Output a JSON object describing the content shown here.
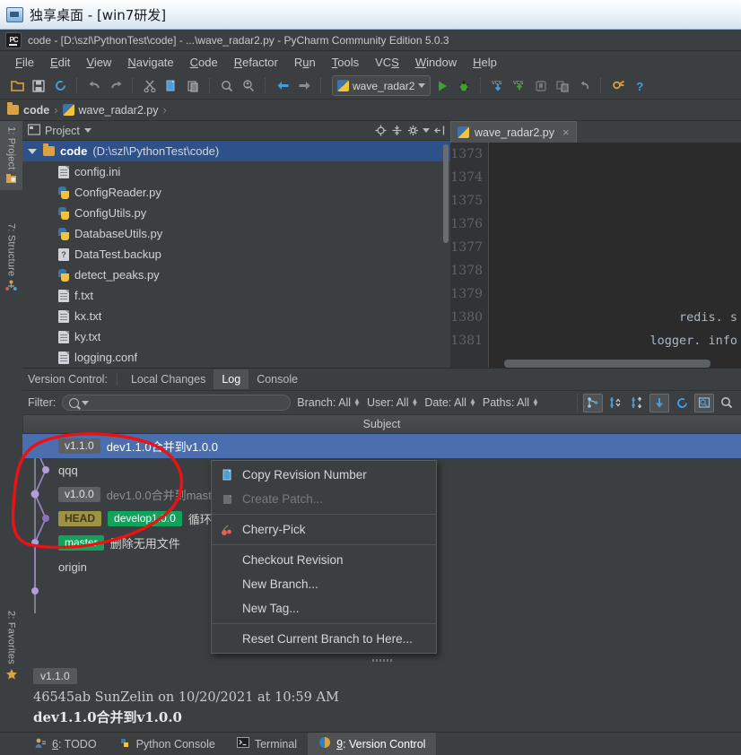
{
  "remote_title": "独享桌面 - [win7研发]",
  "ide_title": "code - [D:\\szl\\PythonTest\\code] - ...\\wave_radar2.py - PyCharm Community Edition 5.0.3",
  "menu": [
    {
      "label": "File",
      "mn": "F"
    },
    {
      "label": "Edit",
      "mn": "E"
    },
    {
      "label": "View",
      "mn": "V"
    },
    {
      "label": "Navigate",
      "mn": "N"
    },
    {
      "label": "Code",
      "mn": "C"
    },
    {
      "label": "Refactor",
      "mn": "R"
    },
    {
      "label": "Run",
      "mn": "u"
    },
    {
      "label": "Tools",
      "mn": "T"
    },
    {
      "label": "VCS",
      "mn": "S"
    },
    {
      "label": "Window",
      "mn": "W"
    },
    {
      "label": "Help",
      "mn": "H"
    }
  ],
  "toolbar": {
    "run_config": "wave_radar2",
    "icons": [
      "open-folder-icon",
      "save-all-icon",
      "sync-icon",
      "undo-icon",
      "redo-icon",
      "cut-icon",
      "copy-icon",
      "paste-icon",
      "find-icon",
      "find-usages-icon",
      "back-icon",
      "forward-icon",
      "run-icon",
      "debug-icon",
      "vcs-update-icon",
      "vcs-commit-icon",
      "toggle-bookmark-icon",
      "compare-icon",
      "rollback-icon",
      "settings-icon",
      "help-icon"
    ]
  },
  "breadcrumb": [
    {
      "label": "code",
      "icon": "folder-icon"
    },
    {
      "label": "wave_radar2.py",
      "icon": "python-file-icon"
    }
  ],
  "left_strip": [
    {
      "label": "1: Project",
      "num": "1",
      "icon": "project-icon",
      "selected": true
    },
    {
      "label": "7: Structure",
      "num": "7",
      "icon": "structure-icon",
      "selected": false
    },
    {
      "label": "2: Favorites",
      "num": "2",
      "icon": "star-icon",
      "selected": false
    }
  ],
  "project": {
    "title": "Project",
    "toolbar_icons": [
      "locate-icon",
      "collapse-all-icon",
      "settings-icon",
      "hide-icon"
    ],
    "root": {
      "name": "code",
      "path": "(D:\\szl\\PythonTest\\code)"
    },
    "files": [
      {
        "name": "config.ini",
        "icon": "text-file-icon"
      },
      {
        "name": "ConfigReader.py",
        "icon": "python-file-icon"
      },
      {
        "name": "ConfigUtils.py",
        "icon": "python-file-icon"
      },
      {
        "name": "DatabaseUtils.py",
        "icon": "python-file-icon"
      },
      {
        "name": "DataTest.backup",
        "icon": "unknown-file-icon"
      },
      {
        "name": "detect_peaks.py",
        "icon": "python-file-icon"
      },
      {
        "name": "f.txt",
        "icon": "text-file-icon"
      },
      {
        "name": "kx.txt",
        "icon": "text-file-icon"
      },
      {
        "name": "ky.txt",
        "icon": "text-file-icon"
      },
      {
        "name": "logging.conf",
        "icon": "text-file-icon"
      }
    ]
  },
  "editor": {
    "tab": "wave_radar2.py",
    "lines": [
      {
        "num": "1373",
        "code": ""
      },
      {
        "num": "1374",
        "code": ""
      },
      {
        "num": "1375",
        "code": ""
      },
      {
        "num": "1376",
        "code": ""
      },
      {
        "num": "1377",
        "code": ""
      },
      {
        "num": "1378",
        "code": ""
      },
      {
        "num": "1379",
        "code": ""
      },
      {
        "num": "1380",
        "code": "redis. s"
      },
      {
        "num": "1381",
        "code": "logger. info"
      }
    ]
  },
  "version_control": {
    "label": "Version Control:",
    "tabs": [
      {
        "label": "Local Changes",
        "selected": false
      },
      {
        "label": "Log",
        "selected": true
      },
      {
        "label": "Console",
        "selected": false
      }
    ],
    "filter_label": "Filter:",
    "search_value": "",
    "dropdowns": [
      {
        "label": "Branch: All"
      },
      {
        "label": "User: All"
      },
      {
        "label": "Date: All"
      },
      {
        "label": "Paths: All"
      }
    ],
    "filter_icons": [
      "show-branches-icon",
      "collapse-graph-icon",
      "expand-graph-icon",
      "go-to-child-icon",
      "refresh-icon",
      "show-details-icon",
      "search-icon"
    ],
    "column_header": "Subject",
    "commits": [
      {
        "refs": [
          {
            "text": "v1.1.0",
            "type": "tag"
          }
        ],
        "subject": "dev1.1.0合并到v1.0.0",
        "selected": true,
        "dim": false
      },
      {
        "refs": [],
        "subject": "qqq",
        "selected": false,
        "dim": false
      },
      {
        "refs": [
          {
            "text": "v1.0.0",
            "type": "tag"
          }
        ],
        "subject": "dev1.0.0合并到maste",
        "selected": false,
        "dim": true
      },
      {
        "refs": [
          {
            "text": "HEAD",
            "type": "head"
          },
          {
            "text": "develop1.0.0",
            "type": "branch"
          }
        ],
        "subject": "循环",
        "selected": false,
        "dim": false
      },
      {
        "refs": [
          {
            "text": "master",
            "type": "branch"
          }
        ],
        "subject": "删除无用文件",
        "selected": false,
        "dim": false
      },
      {
        "refs": [],
        "subject": "origin",
        "selected": false,
        "dim": false
      }
    ],
    "details": {
      "tag": "v1.1.0",
      "meta": "46545ab SunZelin on 10/20/2021 at 10:59 AM",
      "message": "dev1.1.0合并到v1.0.0"
    }
  },
  "context_menu": [
    {
      "label": "Copy Revision Number",
      "icon": "copy-icon",
      "disabled": false,
      "separator_after": false
    },
    {
      "label": "Create Patch...",
      "icon": "patch-icon",
      "disabled": true,
      "separator_after": true
    },
    {
      "label": "Cherry-Pick",
      "icon": "cherry-icon",
      "disabled": false,
      "separator_after": true
    },
    {
      "label": "Checkout Revision",
      "icon": "",
      "disabled": false,
      "separator_after": false
    },
    {
      "label": "New Branch...",
      "icon": "",
      "disabled": false,
      "separator_after": false
    },
    {
      "label": "New Tag...",
      "icon": "",
      "disabled": false,
      "separator_after": true
    },
    {
      "label": "Reset Current Branch to Here...",
      "icon": "",
      "disabled": false,
      "separator_after": false
    }
  ],
  "status_bar": [
    {
      "label": "6: TODO",
      "num": "6",
      "icon": "todo-icon",
      "selected": false
    },
    {
      "label": "Python Console",
      "num": "",
      "icon": "python-console-icon",
      "selected": false
    },
    {
      "label": "Terminal",
      "num": "",
      "icon": "terminal-icon",
      "selected": false
    },
    {
      "label": "9: Version Control",
      "num": "9",
      "icon": "version-control-icon",
      "selected": true
    }
  ],
  "annotation": {
    "shape": "hand-drawn-ellipse",
    "color": "#ee1111"
  }
}
